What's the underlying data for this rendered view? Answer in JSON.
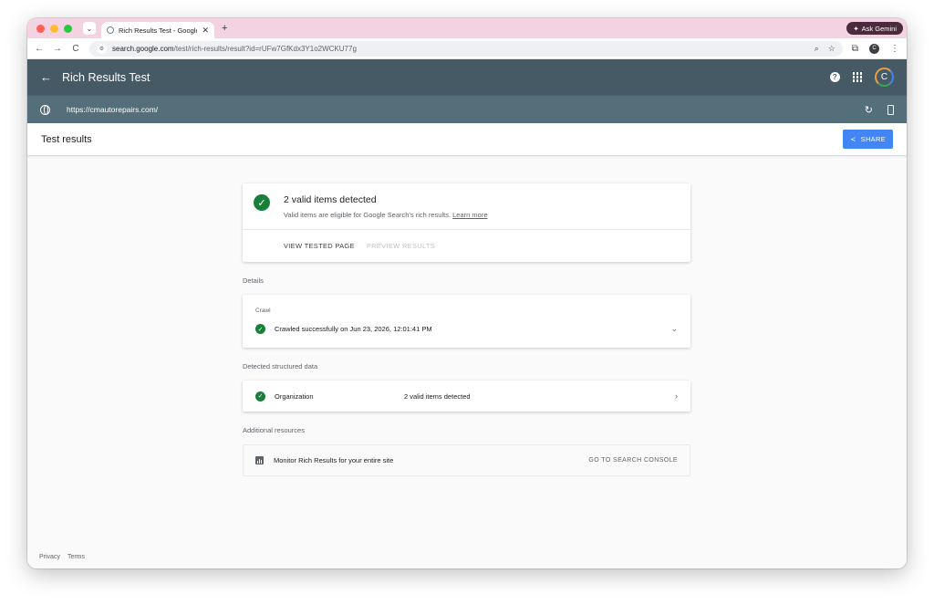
{
  "browser": {
    "tab_title": "Rich Results Test - Google Se",
    "url_domain": "search.google.com",
    "url_path": "/test/rich-results/result?id=rUFw7GfKdx3Y1o2WCKU77g",
    "gemini_label": "Ask Gemini",
    "profile_initial": "C",
    "traffic_colors": [
      "#ff5f57",
      "#febc2e",
      "#28c840"
    ]
  },
  "app": {
    "title": "Rich Results Test",
    "avatar_initial": "C",
    "tested_url": "https://cmautorepairs.com/",
    "header_color": "#455a64"
  },
  "results": {
    "title": "Test results",
    "share_label": "SHARE"
  },
  "summary": {
    "headline": "2 valid items detected",
    "subtext": "Valid items are eligible for Google Search's rich results.",
    "learn_more": "Learn more",
    "view_tested_page": "VIEW TESTED PAGE",
    "preview_results": "PREVIEW RESULTS"
  },
  "details": {
    "label": "Details",
    "crawl_label": "Crawl",
    "crawl_status": "Crawled successfully on Jun 23, 2026, 12:01:41 PM"
  },
  "structured": {
    "label": "Detected structured data",
    "type": "Organization",
    "count": "2 valid items detected"
  },
  "resources": {
    "label": "Additional resources",
    "monitor_text": "Monitor Rich Results for your entire site",
    "console_link": "GO TO SEARCH CONSOLE"
  },
  "footer": {
    "privacy": "Privacy",
    "terms": "Terms"
  }
}
